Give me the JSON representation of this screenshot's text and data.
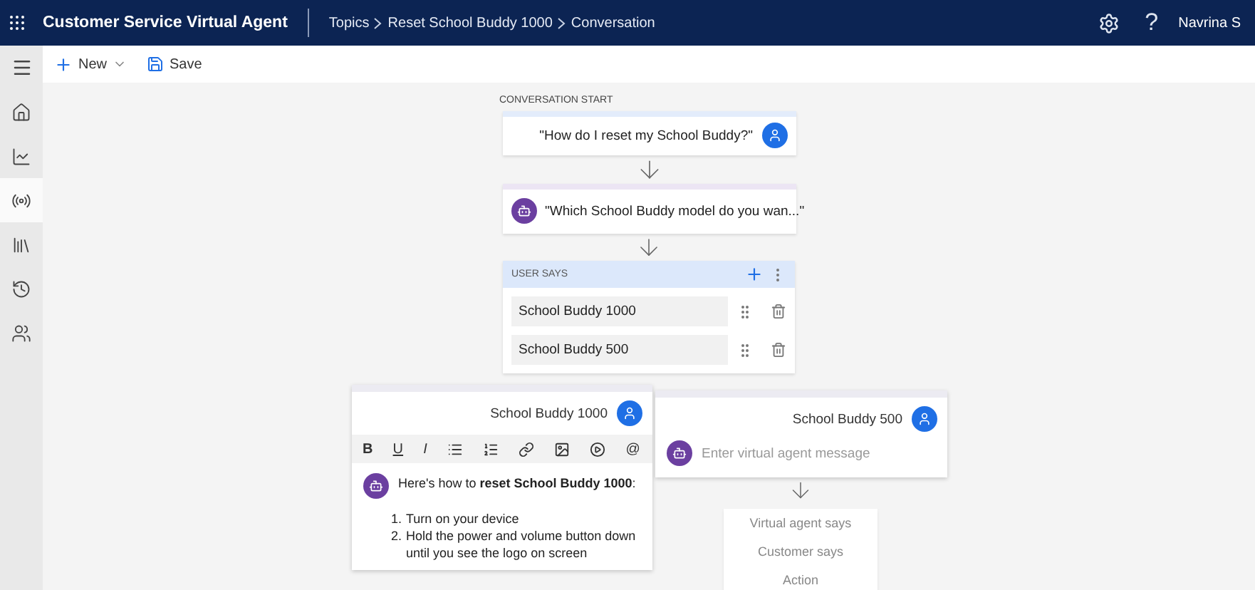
{
  "header": {
    "app_title": "Customer Service Virtual Agent",
    "breadcrumb": [
      "Topics",
      "Reset School Buddy 1000",
      "Conversation"
    ],
    "help": "?",
    "user": "Navrina S"
  },
  "toolbar": [
    {
      "kind": "new",
      "label": "New"
    },
    {
      "kind": "save",
      "label": "Save"
    }
  ],
  "sidebar": {
    "items": [
      {
        "kind": "home",
        "selected": false
      },
      {
        "kind": "analytics",
        "selected": false
      },
      {
        "kind": "topics",
        "selected": true
      },
      {
        "kind": "entities",
        "selected": false
      },
      {
        "kind": "history",
        "selected": false
      },
      {
        "kind": "users",
        "selected": false
      }
    ]
  },
  "canvas": {
    "section_label": "CONVERSATION START",
    "trigger": "\"How do I reset my School Buddy?\"",
    "question": "\"Which School Buddy model do you wan...\"",
    "user_says": {
      "title": "USER SAYS",
      "options": [
        "School Buddy 1000",
        "School Buddy 500"
      ]
    },
    "branches": [
      {
        "kind": "editor",
        "option": "School Buddy 1000",
        "format_buttons": [
          {
            "kind": "bold",
            "label": "B"
          },
          {
            "kind": "underline",
            "label": "U"
          },
          {
            "kind": "italic",
            "label": "I"
          },
          {
            "kind": "bullets"
          },
          {
            "kind": "numbered"
          },
          {
            "kind": "link"
          },
          {
            "kind": "image"
          },
          {
            "kind": "video"
          },
          {
            "kind": "mention",
            "label": "@"
          }
        ],
        "message": "Here's how to **reset School Buddy 1000**:",
        "steps": [
          {
            "number": "1.",
            "text": "Turn on your device"
          },
          {
            "number": "2.",
            "text": "Hold the power and volume button down until you see the logo on screen"
          }
        ]
      },
      {
        "kind": "empty",
        "option": "School Buddy 500",
        "placeholder": "Enter virtual agent message",
        "menu": [
          "Virtual agent says",
          "Customer says",
          "Action"
        ]
      }
    ]
  }
}
